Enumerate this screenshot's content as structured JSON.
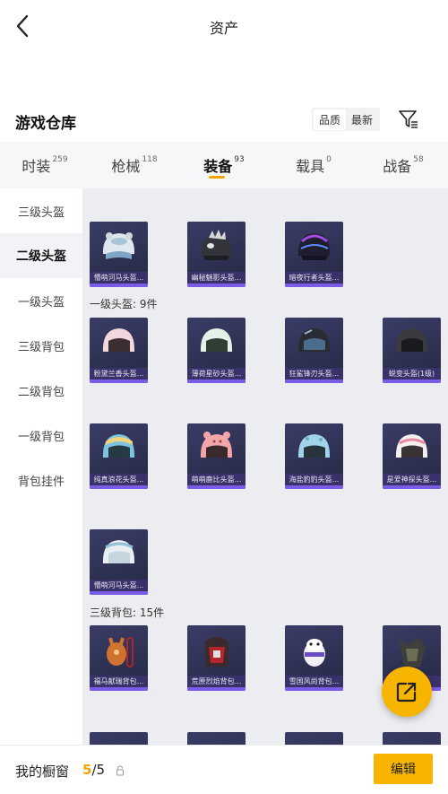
{
  "header": {
    "title": "资产",
    "back_icon": "chevron-left-icon"
  },
  "warehouse": {
    "title": "游戏仓库",
    "sort_options": [
      "品质",
      "最新"
    ],
    "sort_active": "品质",
    "filter_icon": "filter-icon"
  },
  "tabs": [
    {
      "label": "时装",
      "count": "259"
    },
    {
      "label": "枪械",
      "count": "118"
    },
    {
      "label": "装备",
      "count": "93",
      "active": true
    },
    {
      "label": "载具",
      "count": "0"
    },
    {
      "label": "战备",
      "count": "58"
    }
  ],
  "sidebar": [
    {
      "label": "三级头盔"
    },
    {
      "label": "二级头盔",
      "active": true
    },
    {
      "label": "一级头盔"
    },
    {
      "label": "三级背包"
    },
    {
      "label": "二级背包"
    },
    {
      "label": "一级背包"
    },
    {
      "label": "背包挂件"
    }
  ],
  "content": {
    "section_level1_helmets": "一级头盔: 9件",
    "section_level3_backpacks": "三级背包: 15件",
    "level2_helmets": [
      {
        "name": "懵萌河马头盔..."
      },
      {
        "name": "幽秘魅影头盔..."
      },
      {
        "name": "暗夜行者头盔..."
      }
    ],
    "level1_helmets": [
      {
        "name": "粉黛兰香头盔..."
      },
      {
        "name": "薄荷星砂头盔..."
      },
      {
        "name": "狂鲨锋刃头盔..."
      },
      {
        "name": "蜕变头盔(1级)"
      },
      {
        "name": "纯真浪花头盔..."
      },
      {
        "name": "萌萌鹿比头盔..."
      },
      {
        "name": "海盐豹豹头盔..."
      },
      {
        "name": "是爱神探头盔..."
      },
      {
        "name": "懵萌河马头盔..."
      }
    ],
    "level3_backpacks": [
      {
        "name": "福马献瑞背包..."
      },
      {
        "name": "荒原烈焰背包..."
      },
      {
        "name": "雪国风尚背包..."
      },
      {
        "name": ""
      }
    ]
  },
  "bottom": {
    "closet_label": "我的橱窗",
    "closet_current": "5",
    "closet_total": "/5",
    "edit_label": "编辑"
  },
  "fab_icon": "share-external-icon",
  "colors": {
    "accent": "#f7b500",
    "rare_purple": "#7b5ce6",
    "card_bg": "#2f3155"
  }
}
